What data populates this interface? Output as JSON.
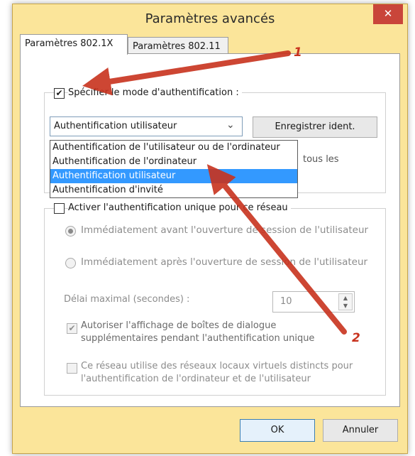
{
  "window": {
    "title": "Paramètres avancés",
    "close_glyph": "✕"
  },
  "tabs": [
    {
      "label": "Paramètres 802.1X"
    },
    {
      "label": "Paramètres 802.11"
    }
  ],
  "auth": {
    "specify_label": "Spécifier le mode d'authentification :",
    "mode_value": "Authentification utilisateur",
    "save_credentials_label": "Enregistrer ident.",
    "partial_text": "tous les",
    "options": [
      "Authentification de l'utilisateur ou de l'ordinateur",
      "Authentification de l'ordinateur",
      "Authentification utilisateur",
      "Authentification d'invité"
    ]
  },
  "sso": {
    "enable_label": "Activer l'authentification unique pour ce réseau",
    "before_logon": "Immédiatement avant l'ouverture de session de l'utilisateur",
    "after_logon": "Immédiatement après l'ouverture de session de l'utilisateur",
    "max_delay_label": "Délai maximal (secondes) :",
    "max_delay_value": "10",
    "allow_dialogs_line1": "Autoriser l'affichage de boîtes de dialogue",
    "allow_dialogs_line2": "supplémentaires pendant l'authentification unique",
    "vlan_line1": "Ce réseau utilise des réseaux locaux virtuels distincts pour",
    "vlan_line2": "l'authentification de l'ordinateur et de l'utilisateur"
  },
  "footer": {
    "ok_label": "OK",
    "cancel_label": "Annuler"
  },
  "annotations": {
    "marker_1": "1",
    "marker_2": "2",
    "arrow_color": "#c8321e"
  }
}
